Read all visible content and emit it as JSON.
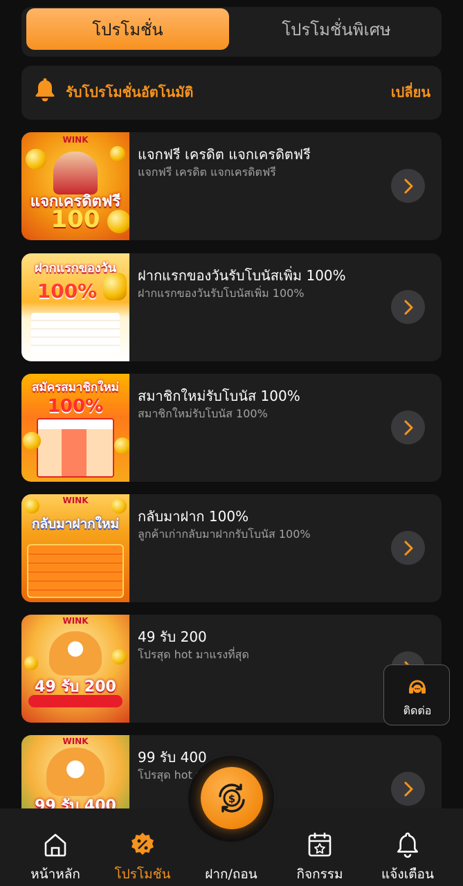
{
  "tabs": [
    {
      "label": "โปรโมชั่น",
      "active": true
    },
    {
      "label": "โปรโมชั่นพิเศษ",
      "active": false
    }
  ],
  "auto_promo": {
    "label": "รับโปรโมชั่นอัตโนมัติ",
    "action": "เปลี่ยน",
    "icon": "bell-icon"
  },
  "promotions": [
    {
      "title": "แจกฟรี เครดิต แจกเครดิตฟรี",
      "subtitle": "แจกฟรี เครดิต แจกเครดิตฟรี",
      "banner_text": "แจกเครดิตฟรี",
      "banner_number": "100",
      "brand": "WINK"
    },
    {
      "title": "ฝากแรกของวันรับโบนัสเพิ่ม 100%",
      "subtitle": "ฝากแรกของวันรับโบนัสเพิ่ม 100%",
      "banner_text": "ฝากแรกของวัน",
      "banner_number": "100%"
    },
    {
      "title": "สมาชิกใหม่รับโบนัส 100%",
      "subtitle": "สมาชิกใหม่รับโบนัส 100%",
      "banner_text": "สมัครสมาชิกใหม่",
      "banner_number": "100%"
    },
    {
      "title": "กลับมาฝาก 100%",
      "subtitle": "ลูกค้าเก่ากลับมาฝากรับโบนัส 100%",
      "banner_text": "กลับมาฝากใหม่",
      "brand": "WINK"
    },
    {
      "title": "49 รับ 200",
      "subtitle": "โปรสุด hot มาแรงที่สุด",
      "banner_text": "49 รับ 200",
      "brand": "WINK"
    },
    {
      "title": "99 รับ 400",
      "subtitle": "โปรสุด hot มาแรงที่สุด",
      "banner_text": "99 รับ 400",
      "brand": "WINK"
    }
  ],
  "contact": {
    "label": "ติดต่อ",
    "icon": "headset-icon"
  },
  "bottom_nav": [
    {
      "label": "หน้าหลัก",
      "icon": "home-icon",
      "active": false
    },
    {
      "label": "โปรโมชัน",
      "icon": "promo-badge-icon",
      "active": true
    },
    {
      "label": "ฝาก/ถอน",
      "icon": "deposit-withdraw-icon",
      "active": false
    },
    {
      "label": "กิจกรรม",
      "icon": "calendar-star-icon",
      "active": false
    },
    {
      "label": "แจ้งเตือน",
      "icon": "bell-icon",
      "active": false
    }
  ],
  "colors": {
    "accent": "#f7941d",
    "background": "#0f0f10",
    "card": "#1e1e1f",
    "muted_text": "#a3a3a3"
  }
}
